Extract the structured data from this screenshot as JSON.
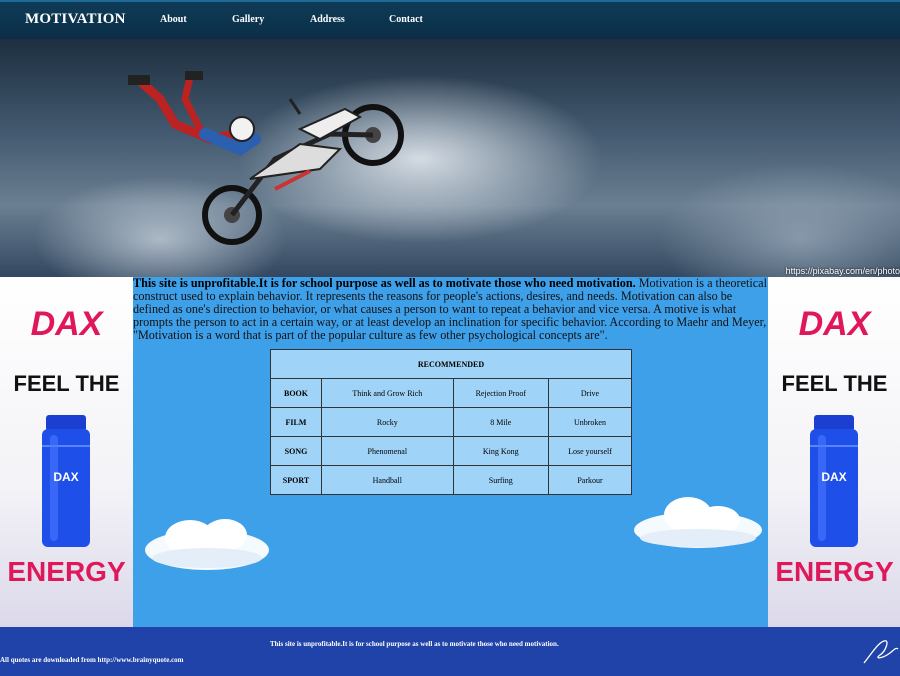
{
  "nav": {
    "logo": "MOTIVATION",
    "links": [
      "About",
      "Gallery",
      "Address",
      "Contact"
    ]
  },
  "hero": {
    "credit": "https://pixabay.com/en/photo"
  },
  "ad": {
    "brand": "DAX",
    "line1": "FEEL THE",
    "line2": "ENERGY",
    "bottle_brand": "DAX"
  },
  "content": {
    "intro_bold": "This site is unprofitable.It is for school purpose as well as to motivate those who need motivation.",
    "intro_text": " Motivation is a theoretical construct used to explain behavior. It represents the reasons for people's actions, desires, and needs. Motivation can also be defined as one's direction to behavior, or what causes a person to want to repeat a behavior and vice versa. A motive is what prompts the person to act in a certain way, or at least develop an inclination for specific behavior. According to Maehr and Meyer, \"Motivation is a word that is part of the popular culture as few other psychological concepts are\"."
  },
  "table": {
    "header": "RECOMMENDED",
    "rows": [
      {
        "category": "BOOK",
        "items": [
          "Think and Grow Rich",
          "Rejection Proof",
          "Drive"
        ]
      },
      {
        "category": "FILM",
        "items": [
          "Rocky",
          "8 Mile",
          "Unbroken"
        ]
      },
      {
        "category": "SONG",
        "items": [
          "Phenomenal",
          "King Kong",
          "Lose yourself"
        ]
      },
      {
        "category": "SPORT",
        "items": [
          "Handball",
          "Surfing",
          "Parkour"
        ]
      }
    ]
  },
  "footer": {
    "main": "This site is unprofitable.It is for school purpose as well as to motivate those who need motivation.",
    "quotes": "All quotes are downloaded from http://www.brainyquote.com"
  },
  "colors": {
    "page_bg": "#3fa0ea",
    "nav_bg": "#0f3b57",
    "footer_bg": "#1f43a8",
    "table_bg": "#9fd3f7",
    "ad_accent": "#e0185a"
  },
  "icons": [
    "motocross-rider-photo",
    "cloud-icon",
    "bottle-image",
    "signature-icon"
  ]
}
